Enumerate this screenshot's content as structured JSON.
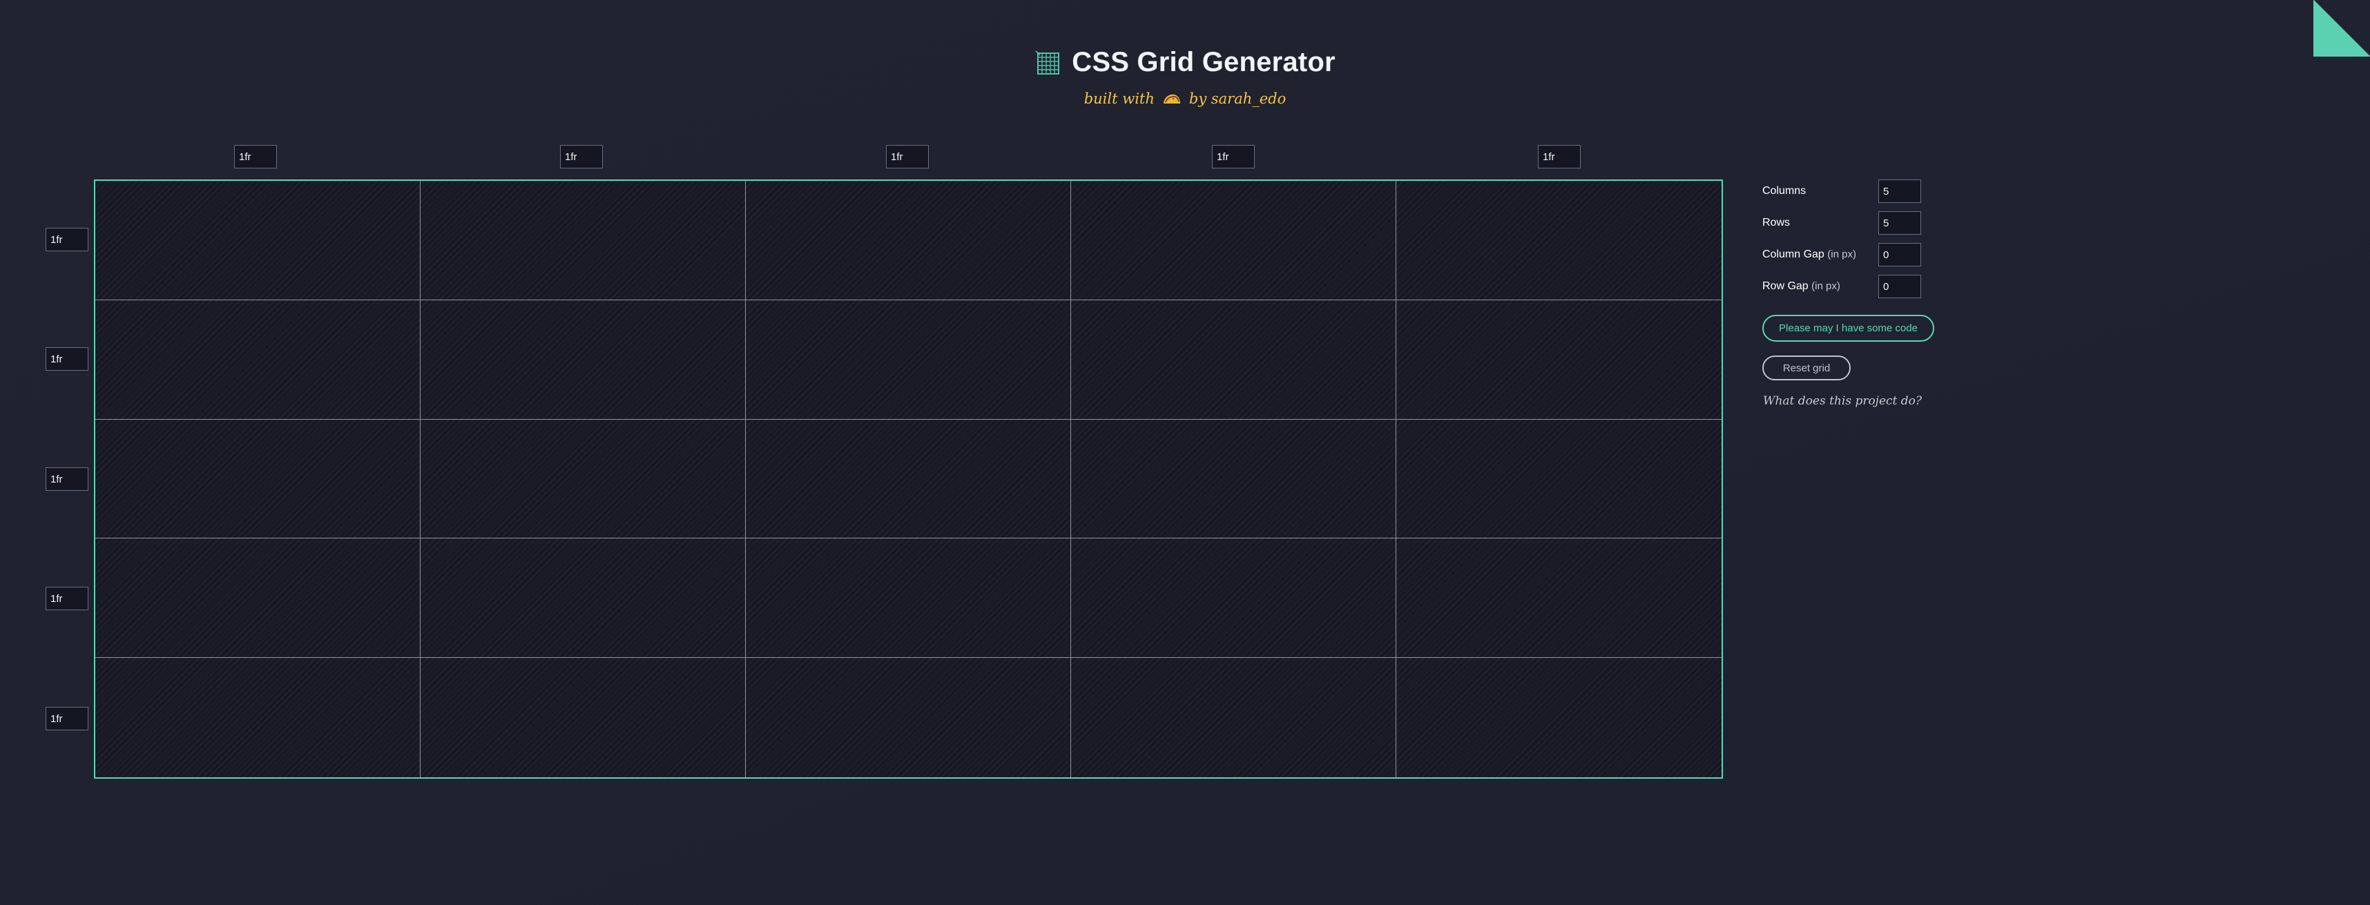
{
  "header": {
    "title": "CSS Grid Generator",
    "subtitle_prefix": "built with",
    "subtitle_suffix": "by sarah_edo"
  },
  "grid": {
    "columns": [
      "1fr",
      "1fr",
      "1fr",
      "1fr",
      "1fr"
    ],
    "rows": [
      "1fr",
      "1fr",
      "1fr",
      "1fr",
      "1fr"
    ]
  },
  "controls": {
    "columns_label": "Columns",
    "columns_value": "5",
    "rows_label": "Rows",
    "rows_value": "5",
    "column_gap_label": "Column Gap",
    "column_gap_unit": "(in px)",
    "column_gap_value": "0",
    "row_gap_label": "Row Gap",
    "row_gap_unit": "(in px)",
    "row_gap_value": "0"
  },
  "buttons": {
    "code_label": "Please may I have some code",
    "reset_label": "Reset grid"
  },
  "links": {
    "about_label": "What does this project do?"
  },
  "colors": {
    "accent": "#5fd5b2",
    "subtitle": "#f4c542",
    "background": "#222331"
  },
  "icons": {
    "title_icon": "grid-icon",
    "heart_icon": "taco-icon",
    "corner_icon": "github-octocat-icon"
  }
}
